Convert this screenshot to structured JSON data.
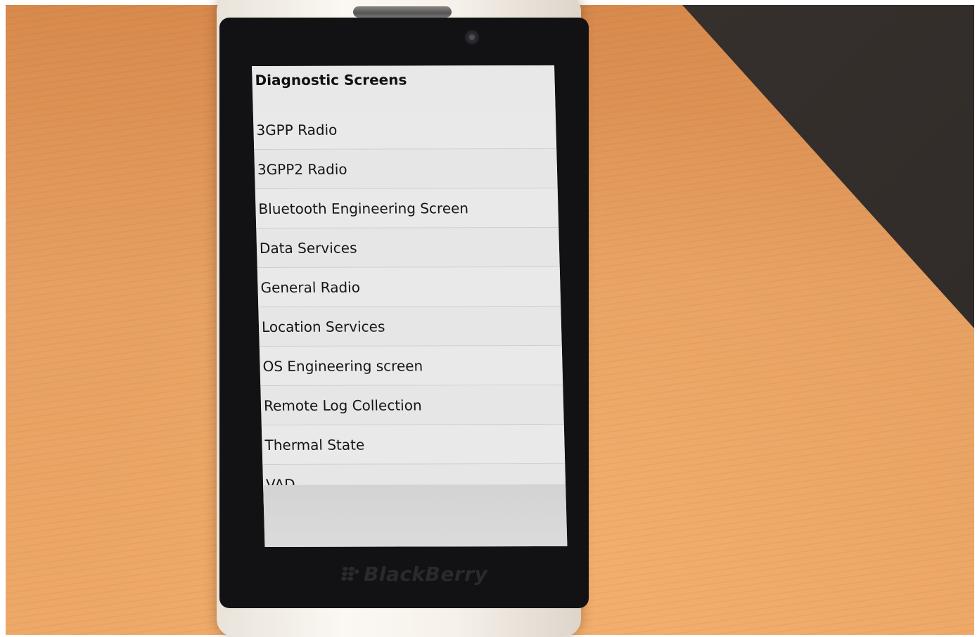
{
  "screen": {
    "title": "Diagnostic Screens",
    "items": [
      {
        "label": "3GPP Radio"
      },
      {
        "label": "3GPP2 Radio"
      },
      {
        "label": "Bluetooth Engineering Screen"
      },
      {
        "label": "Data Services"
      },
      {
        "label": "General Radio"
      },
      {
        "label": "Location Services"
      },
      {
        "label": "OS Engineering screen"
      },
      {
        "label": "Remote Log Collection"
      },
      {
        "label": "Thermal State"
      },
      {
        "label": "VAD"
      }
    ]
  },
  "device": {
    "brand": "BlackBerry"
  },
  "colors": {
    "table": "#e6a062",
    "bezel": "#121214",
    "screen_bg": "#e8e8e8"
  }
}
